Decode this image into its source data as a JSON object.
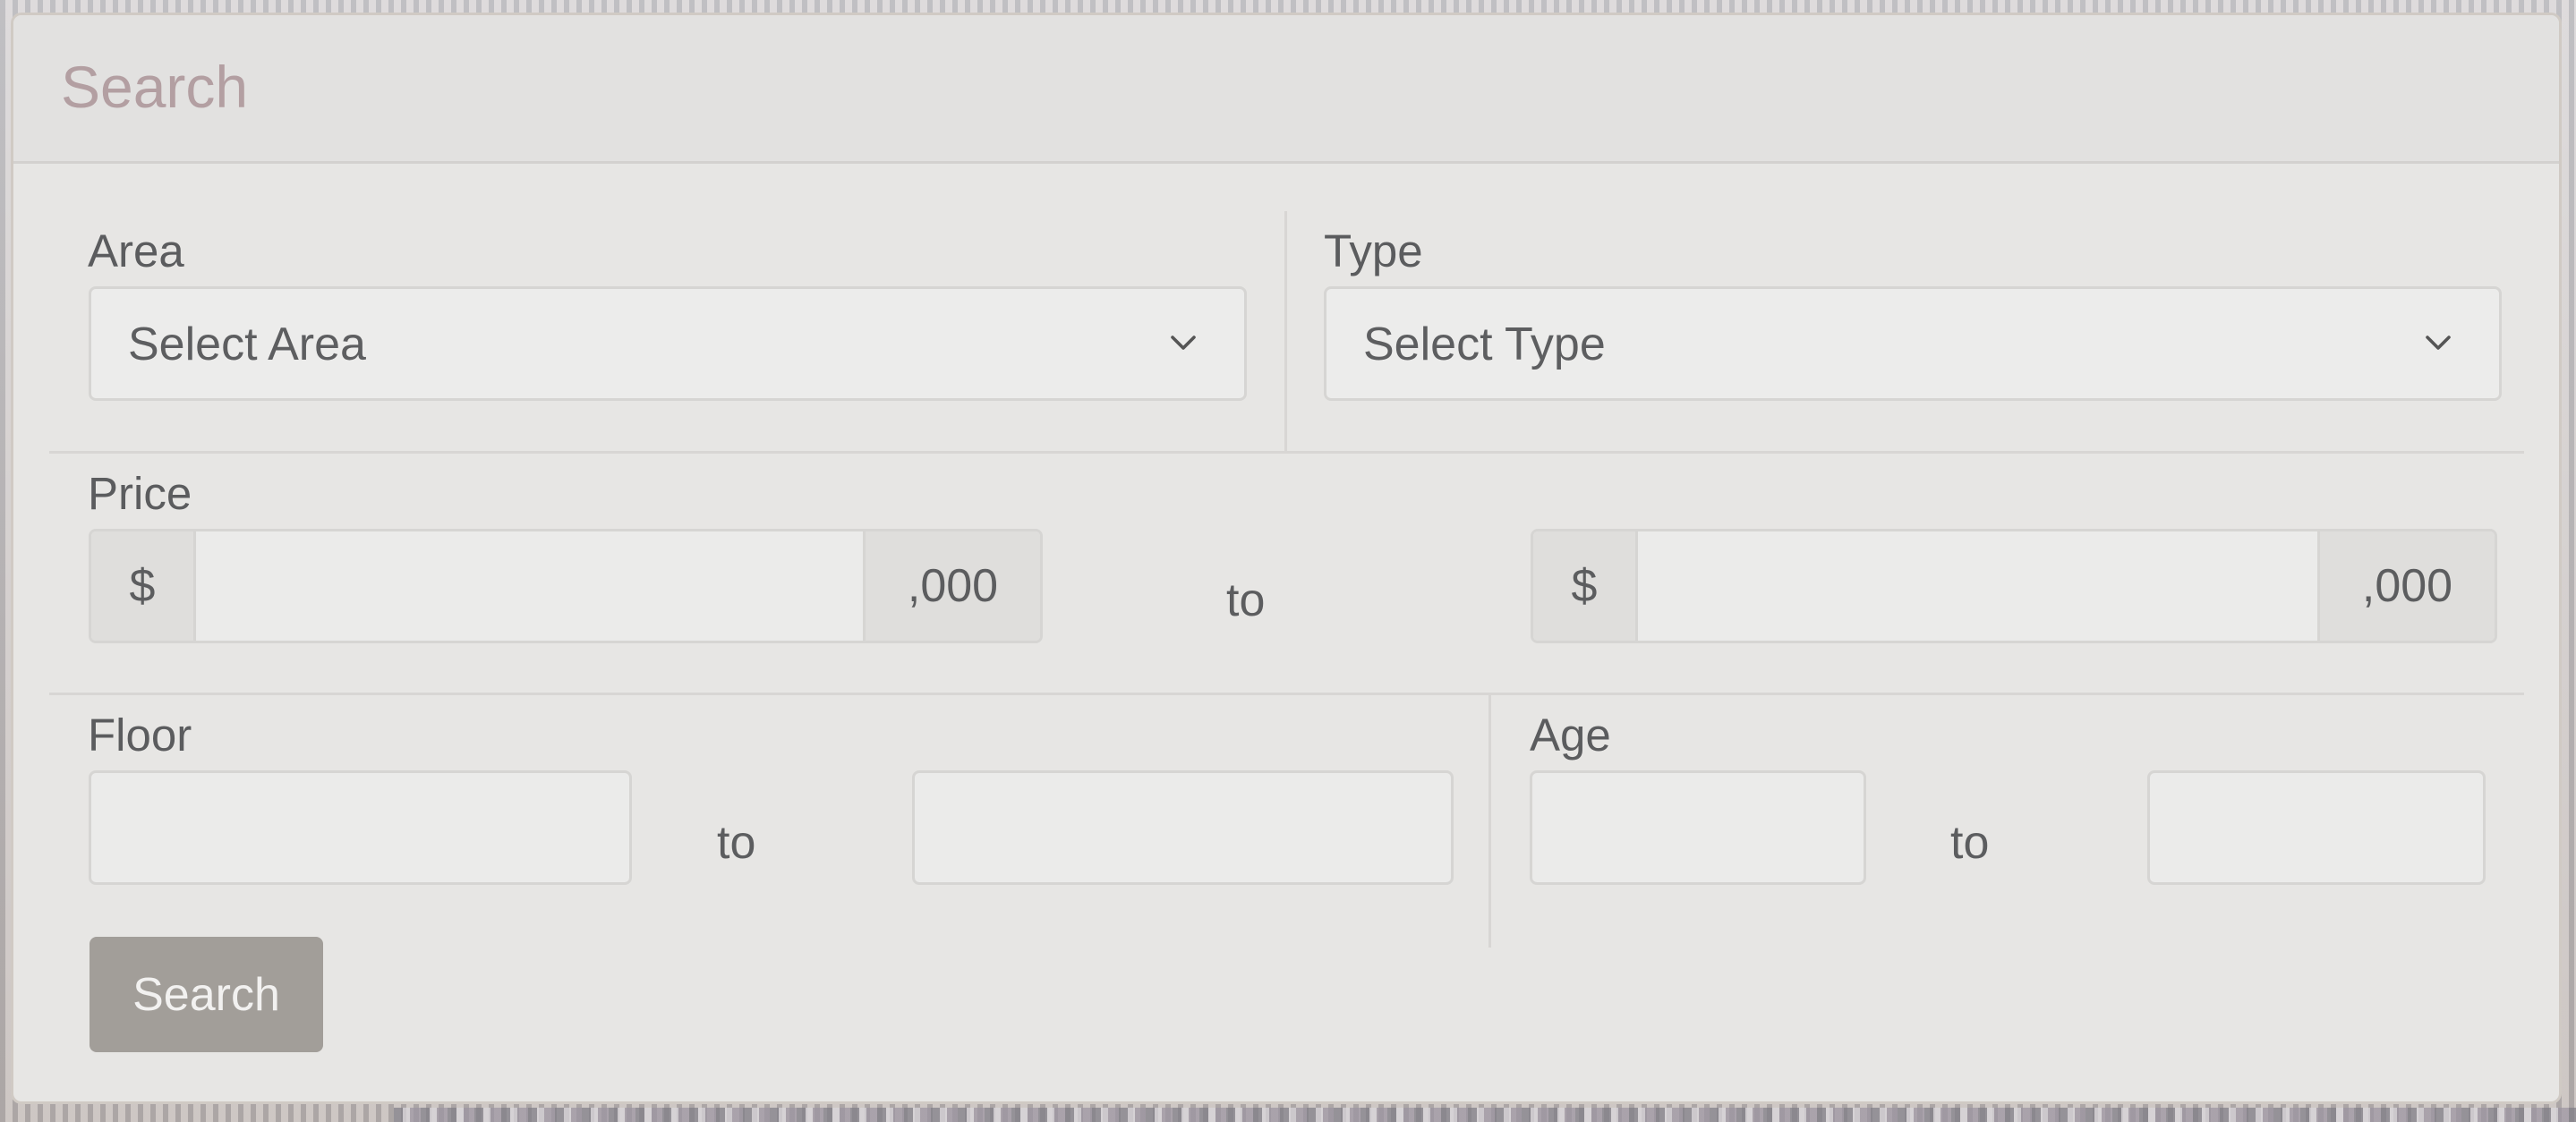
{
  "panel": {
    "title": "Search"
  },
  "area": {
    "label": "Area",
    "selected": "Select Area"
  },
  "type": {
    "label": "Type",
    "selected": "Select Type"
  },
  "price": {
    "label": "Price",
    "currency_symbol": "$",
    "suffix": ",000",
    "min_value": "",
    "max_value": "",
    "to_text": "to"
  },
  "floor": {
    "label": "Floor",
    "min_value": "",
    "max_value": "",
    "to_text": "to"
  },
  "age": {
    "label": "Age",
    "min_value": "",
    "max_value": "",
    "to_text": "to"
  },
  "actions": {
    "search_label": "Search"
  },
  "icons": {
    "select_chevron": "chevron-down-icon"
  },
  "colors": {
    "title": "#b39fa2",
    "button": "#a29e99",
    "panel_bg": "#e7e6e4"
  }
}
